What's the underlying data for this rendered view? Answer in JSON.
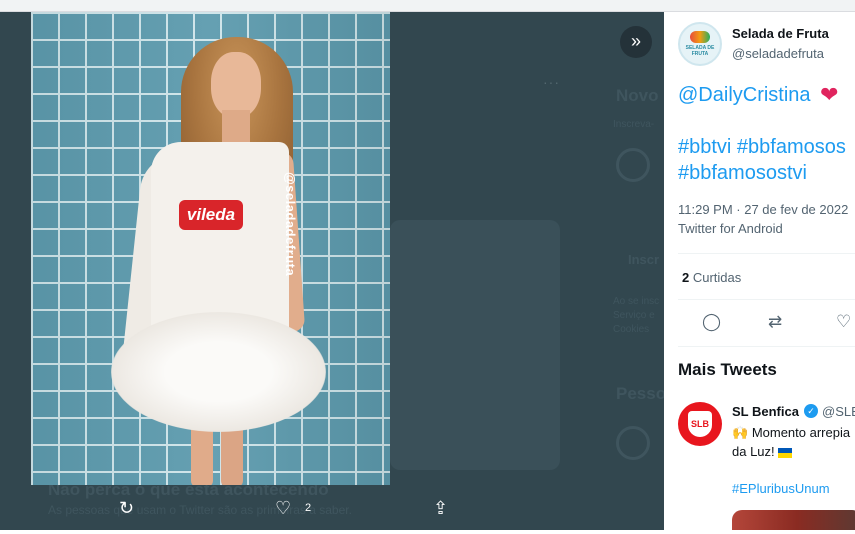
{
  "viewer": {
    "background_texts": {
      "novo": "Novo",
      "inscreva": "Inscreva-",
      "inscr": "Inscr",
      "ao_se": "Ao se insc",
      "servico": "Serviço e",
      "cookies": "Cookies",
      "pessoa": "Pessoa",
      "banner_title": "Não perca o que está acontecendo",
      "banner_sub": "As pessoas que usam o Twitter são as primeiras a saber."
    },
    "photo": {
      "brand_label": "vileda",
      "watermark": "@seladadefruta"
    },
    "actions": {
      "retweet_icon": "↻",
      "like_icon": "♡",
      "like_count": "2",
      "share_icon": "⇪"
    },
    "expand_icon": "»",
    "more_icon": "···"
  },
  "tweet": {
    "author_name": "Selada de Fruta",
    "author_handle": "@seladadefruta",
    "avatar_text": "SELADA DE FRUTA",
    "mention": "@DailyCristina",
    "heart": "❤",
    "hashtags_line1": "#bbtvi #bbfamosos",
    "hashtags_line2": "#bbfamosostvi",
    "timestamp": "11:29 PM · 27 de fev de 2022",
    "source": "Twitter for Android",
    "retweets_count": "2",
    "retweets_label": "Curtidas",
    "reply_icon": "◯",
    "retweet_icon": "⇄",
    "like_icon": "♡"
  },
  "more_tweets": {
    "title": "Mais Tweets",
    "items": [
      {
        "name": "SL Benfica",
        "handle": "@SLB",
        "verified_icon": "✓",
        "logo_text": "SLB",
        "text_line1": "Momento arrepia",
        "text_line2": "da Luz!",
        "emoji": "🙌",
        "hashtag": "#EPluribusUnum"
      }
    ]
  },
  "colors": {
    "accent": "#1d9bf0",
    "viewer_bg": "#32474f",
    "brand_red": "#d9252a"
  }
}
